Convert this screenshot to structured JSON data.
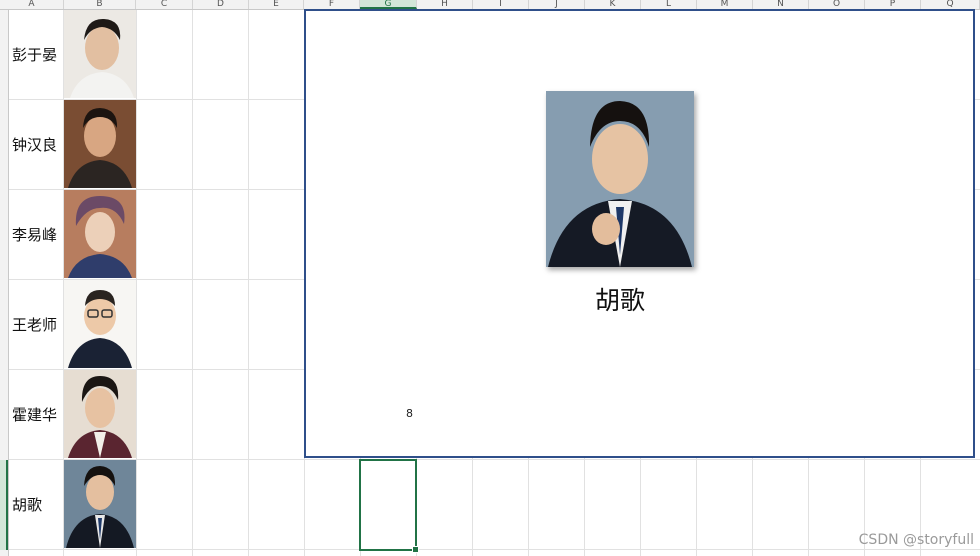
{
  "spreadsheet": {
    "columns": [
      "A",
      "B",
      "C",
      "D",
      "E",
      "F",
      "G",
      "H",
      "I",
      "J",
      "K",
      "L",
      "M",
      "N",
      "O",
      "P",
      "Q"
    ],
    "active_column": "G",
    "rows": [
      {
        "name": "彭于晏",
        "photo_icon": "portrait-photo"
      },
      {
        "name": "钟汉良",
        "photo_icon": "portrait-photo"
      },
      {
        "name": "李易峰",
        "photo_icon": "portrait-photo"
      },
      {
        "name": "王老师",
        "photo_icon": "portrait-photo"
      },
      {
        "name": "霍建华",
        "photo_icon": "portrait-photo"
      },
      {
        "name": "胡歌",
        "photo_icon": "portrait-photo"
      }
    ]
  },
  "popup": {
    "name": "胡歌",
    "stray_value": "8",
    "border_color": "#2f4f8a"
  },
  "watermark": "CSDN @storyfull",
  "colors": {
    "accent": "#217346",
    "card_border": "#2f4f8a"
  }
}
